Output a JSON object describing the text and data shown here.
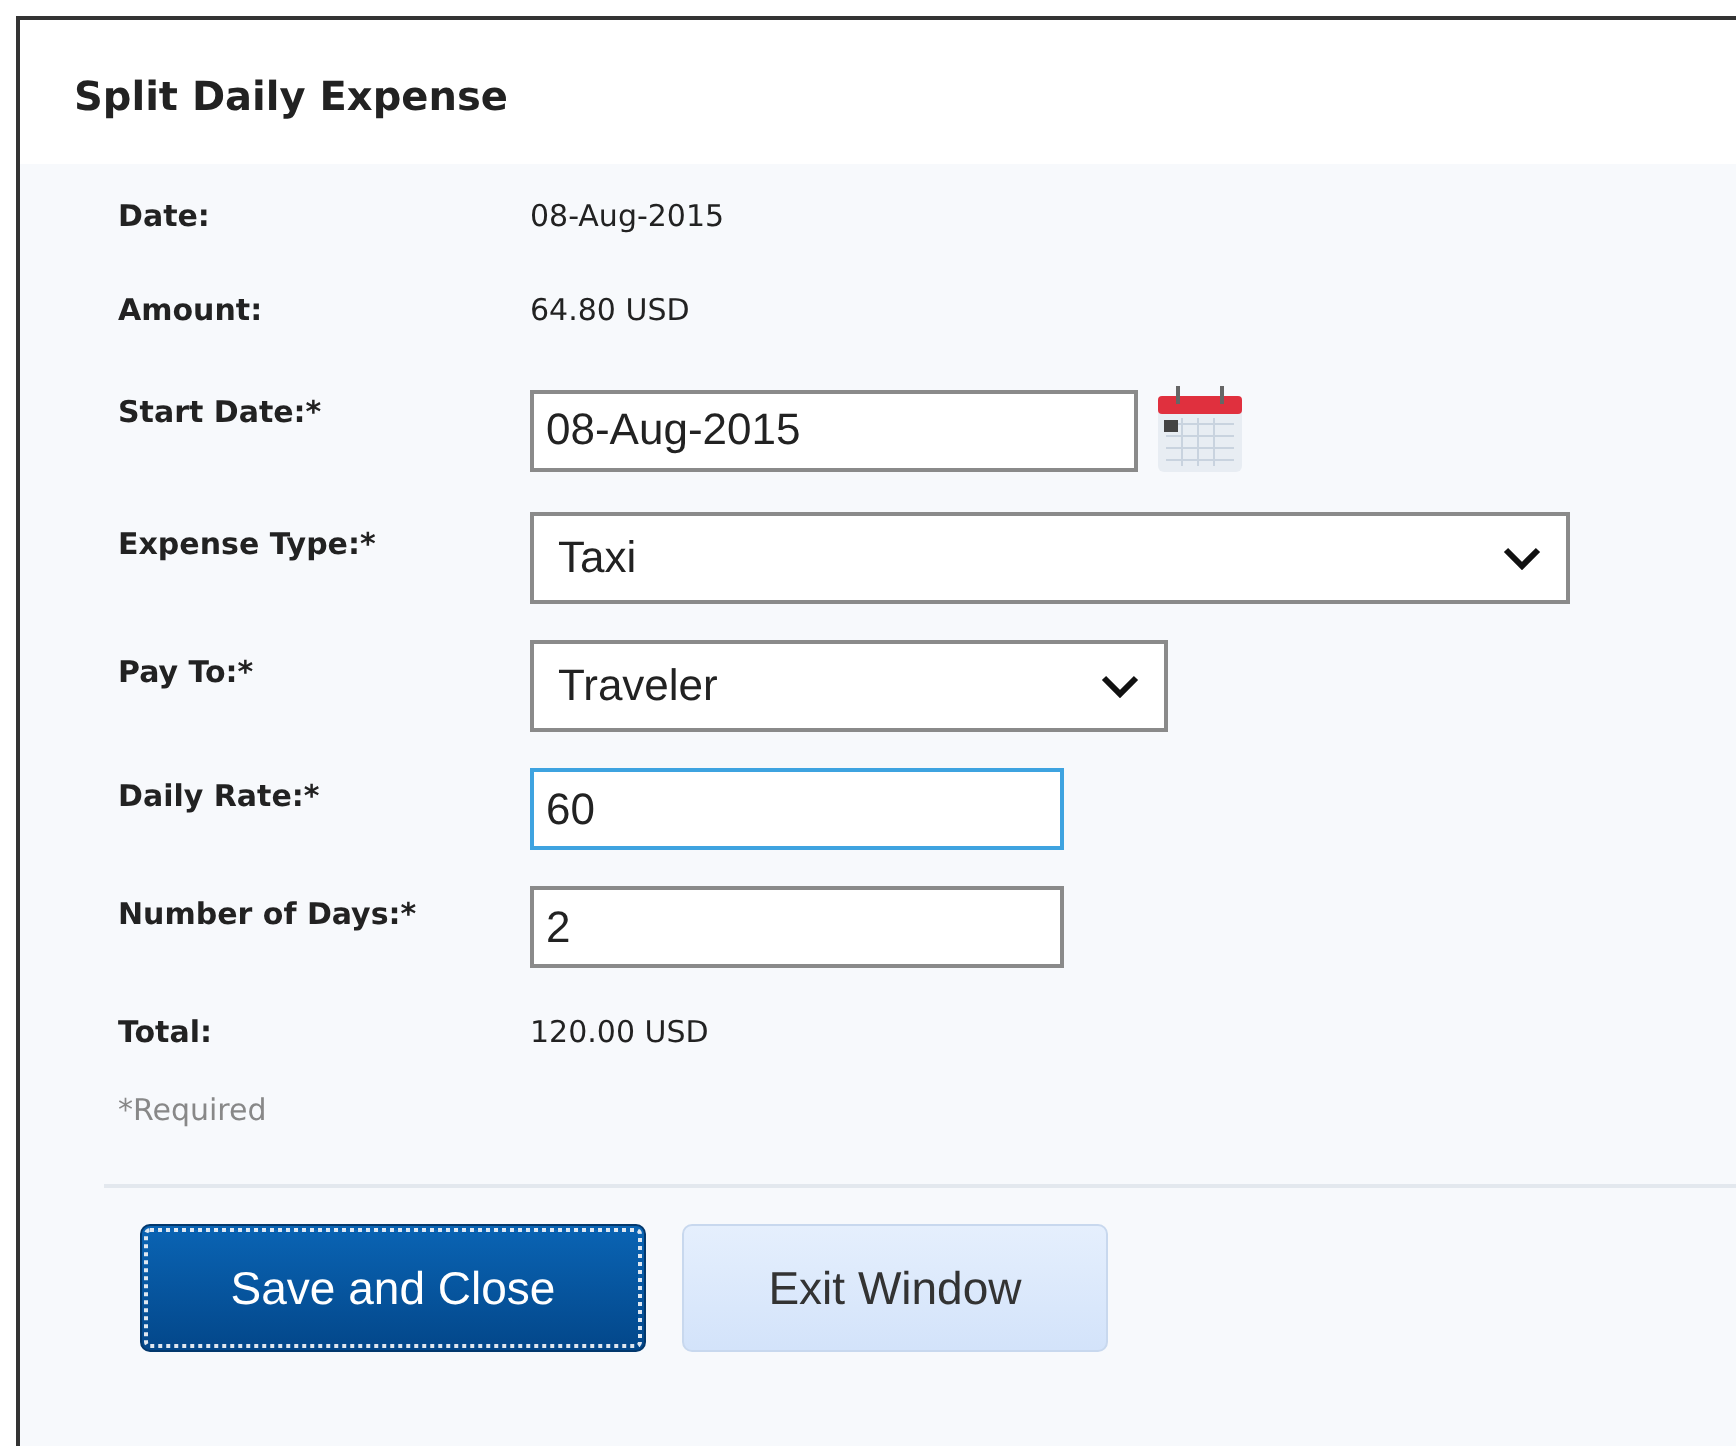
{
  "dialog": {
    "title": "Split Daily Expense"
  },
  "rows": [
    {
      "kind": "info",
      "label": "Date:",
      "value": "08-Aug-2015"
    },
    {
      "kind": "info",
      "label": "Amount:",
      "value": "64.80 USD"
    },
    {
      "kind": "date",
      "label": "Start Date:*",
      "value": "08-Aug-2015",
      "focused": false
    },
    {
      "kind": "select",
      "label": "Expense Type:*",
      "value": "Taxi"
    },
    {
      "kind": "select",
      "label": "Pay To:*",
      "value": "Traveler"
    },
    {
      "kind": "text",
      "label": "Daily Rate:*",
      "value": "60",
      "focused": true
    },
    {
      "kind": "text",
      "label": "Number of Days:*",
      "value": "2",
      "focused": false
    },
    {
      "kind": "info",
      "label": "Total:",
      "value": "120.00 USD"
    }
  ],
  "required_note": "*Required",
  "buttons": [
    {
      "label": "Save and Close",
      "kind": "primary"
    },
    {
      "label": "Exit Window",
      "kind": "secondary"
    }
  ]
}
